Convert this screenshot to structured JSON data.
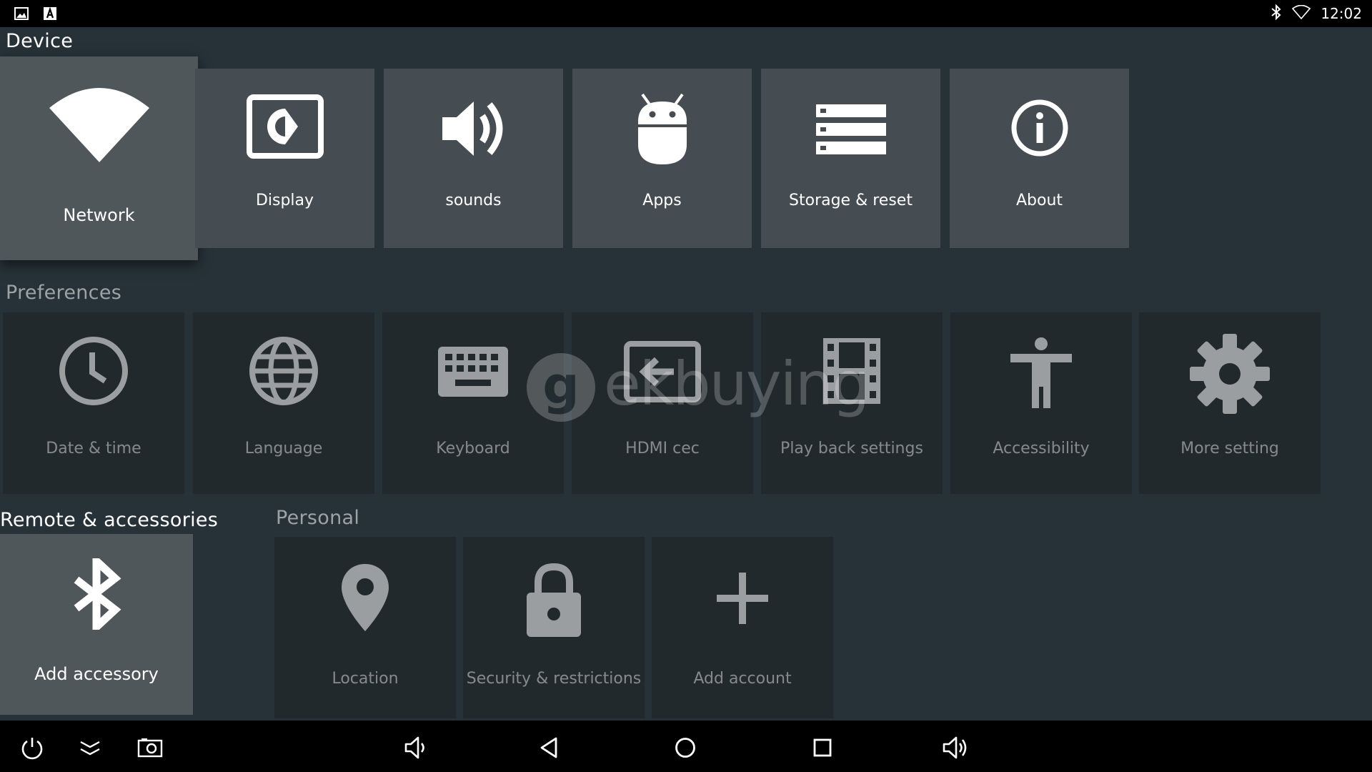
{
  "statusbar": {
    "left_icons": [
      "image-icon",
      "text-a-icon"
    ],
    "right_icons": [
      "bluetooth-icon",
      "wifi-icon"
    ],
    "time": "12:02"
  },
  "sections": {
    "device": "Device",
    "preferences": "Preferences",
    "remote": "Remote & accessories",
    "personal": "Personal"
  },
  "device_items": [
    {
      "label": "Network",
      "icon": "wifi-icon"
    },
    {
      "label": "Display",
      "icon": "display-icon"
    },
    {
      "label": "sounds",
      "icon": "speaker-icon"
    },
    {
      "label": "Apps",
      "icon": "android-icon"
    },
    {
      "label": "Storage & reset",
      "icon": "storage-icon"
    },
    {
      "label": "About",
      "icon": "info-icon"
    }
  ],
  "preference_items": [
    {
      "label": "Date & time",
      "icon": "clock-icon"
    },
    {
      "label": "Language",
      "icon": "globe-icon"
    },
    {
      "label": "Keyboard",
      "icon": "keyboard-icon"
    },
    {
      "label": "HDMI cec",
      "icon": "input-icon"
    },
    {
      "label": "Play back settings",
      "icon": "film-icon"
    },
    {
      "label": "Accessibility",
      "icon": "accessibility-icon"
    },
    {
      "label": "More setting",
      "icon": "gear-icon"
    }
  ],
  "remote_items": [
    {
      "label": "Add accessory",
      "icon": "bluetooth-icon"
    }
  ],
  "personal_items": [
    {
      "label": "Location",
      "icon": "location-pin-icon"
    },
    {
      "label": "Security & restrictions",
      "icon": "lock-icon"
    },
    {
      "label": "Add account",
      "icon": "plus-icon"
    }
  ],
  "watermark": "ekbuying",
  "navbar": {
    "icons": [
      "power-icon",
      "collapse-icon",
      "screenshot-icon",
      "volume-down-icon",
      "back-icon",
      "home-icon",
      "recents-icon",
      "volume-up-icon"
    ]
  }
}
